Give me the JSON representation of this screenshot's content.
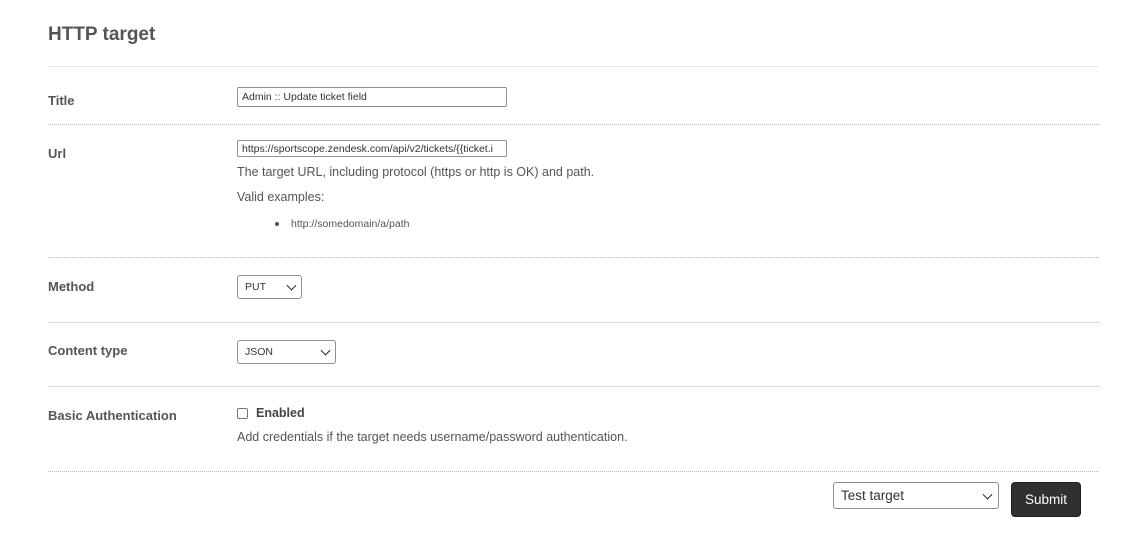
{
  "page": {
    "title": "HTTP target"
  },
  "fields": {
    "title": {
      "label": "Title",
      "value": "Admin :: Update ticket field"
    },
    "url": {
      "label": "Url",
      "value": "https://sportscope.zendesk.com/api/v2/tickets/{{ticket.i",
      "hint": "The target URL, including protocol (https or http is OK) and path.",
      "examples_label": "Valid examples:",
      "examples": [
        "http://somedomain/a/path"
      ]
    },
    "method": {
      "label": "Method",
      "selected": "PUT"
    },
    "content_type": {
      "label": "Content type",
      "selected": "JSON"
    },
    "basic_auth": {
      "label": "Basic Authentication",
      "checkbox_label": "Enabled",
      "checked": false,
      "hint": "Add credentials if the target needs username/password authentication."
    }
  },
  "footer": {
    "action_select": "Test target",
    "submit_label": "Submit"
  },
  "icons": {
    "dropdown": "chevron-down-icon",
    "bullet": "bullet-icon"
  },
  "colors": {
    "submit_bg": "#303030",
    "label_text": "#555555"
  }
}
